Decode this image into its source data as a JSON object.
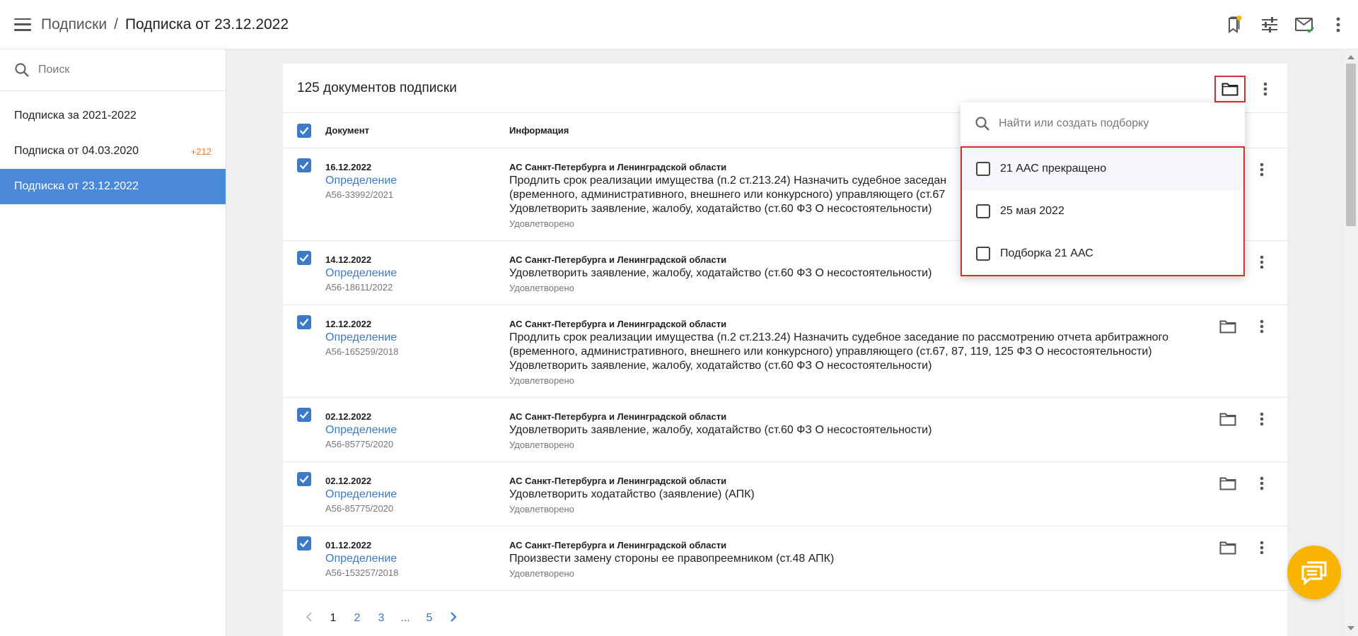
{
  "header": {
    "breadcrumb_root": "Подписки",
    "breadcrumb_sep": "/",
    "breadcrumb_current": "Подписка от 23.12.2022",
    "notification_dot_color": "#f8b400"
  },
  "sidebar": {
    "search_placeholder": "Поиск",
    "items": [
      {
        "label": "Подписка за 2021-2022",
        "count": ""
      },
      {
        "label": "Подписка от 04.03.2020",
        "count": "+212"
      },
      {
        "label": "Подписка от 23.12.2022",
        "count": "",
        "active": true
      }
    ]
  },
  "main": {
    "title": "125 документов подписки",
    "col_document": "Документ",
    "col_info": "Информация",
    "rows": [
      {
        "date": "16.12.2022",
        "type": "Определение",
        "number": "А56-33992/2021",
        "court": "АС Санкт-Петербурга и Ленинградской области",
        "lines": [
          "Продлить срок реализации имущества (п.2 ст.213.24) Назначить судебное заседан",
          "(временного, административного, внешнего или конкурсного) управляющего (ст.67",
          "Удовлетворить заявление, жалобу, ходатайство (ст.60 ФЗ О несостоятельности)"
        ],
        "status": "Удовлетворено"
      },
      {
        "date": "14.12.2022",
        "type": "Определение",
        "number": "А56-18611/2022",
        "court": "АС Санкт-Петербурга и Ленинградской области",
        "lines": [
          "Удовлетворить заявление, жалобу, ходатайство (ст.60 ФЗ О несостоятельности)"
        ],
        "status": "Удовлетворено"
      },
      {
        "date": "12.12.2022",
        "type": "Определение",
        "number": "А56-165259/2018",
        "court": "АС Санкт-Петербурга и Ленинградской области",
        "lines": [
          "Продлить срок реализации имущества (п.2 ст.213.24) Назначить судебное заседание по рассмотрению отчета арбитражного",
          "(временного, административного, внешнего или конкурсного) управляющего (ст.67, 87, 119, 125 ФЗ О несостоятельности)",
          "Удовлетворить заявление, жалобу, ходатайство (ст.60 ФЗ О несостоятельности)"
        ],
        "status": "Удовлетворено"
      },
      {
        "date": "02.12.2022",
        "type": "Определение",
        "number": "А56-85775/2020",
        "court": "АС Санкт-Петербурга и Ленинградской области",
        "lines": [
          "Удовлетворить заявление, жалобу, ходатайство (ст.60 ФЗ О несостоятельности)"
        ],
        "status": "Удовлетворено"
      },
      {
        "date": "02.12.2022",
        "type": "Определение",
        "number": "А56-85775/2020",
        "court": "АС Санкт-Петербурга и Ленинградской области",
        "lines": [
          "Удовлетворить ходатайство (заявление) (АПК)"
        ],
        "status": "Удовлетворено"
      },
      {
        "date": "01.12.2022",
        "type": "Определение",
        "number": "А56-153257/2018",
        "court": "АС Санкт-Петербурга и Ленинградской области",
        "lines": [
          "Произвести замену стороны ее правопреемником (ст.48 АПК)"
        ],
        "status": "Удовлетворено"
      }
    ],
    "pagination": {
      "pages": [
        "1",
        "2",
        "3",
        "...",
        "5"
      ],
      "current": "1"
    }
  },
  "dropdown": {
    "search_placeholder": "Найти или создать подборку",
    "items": [
      "21 ААС прекращено",
      "25 мая 2022",
      "Подборка 21 ААС"
    ]
  },
  "colors": {
    "accent": "#3c7ac7",
    "active_sidebar": "#4a88d9",
    "highlight_border": "#d32f2f",
    "badge": "#f07a2a",
    "fab": "#f8b400"
  }
}
